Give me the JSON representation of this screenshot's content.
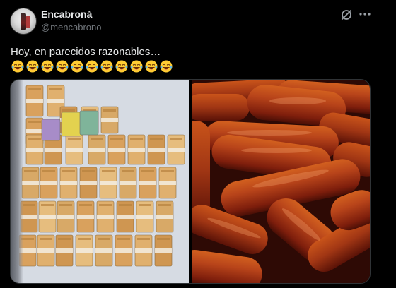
{
  "tweet": {
    "author_name": "Encabroná",
    "author_handle": "@mencabrono",
    "text": "Hoy, en parecidos razonables…",
    "emoji_count": 11,
    "emoji": "laughing-crying-face"
  },
  "icons": {
    "grok": "grok-icon",
    "more": "more-icon"
  },
  "media": {
    "left_image": "euro-banknote-bundles",
    "right_image": "chorizo-sausages"
  },
  "colors": {
    "background": "#000000",
    "text_primary": "#e7e9ea",
    "text_secondary": "#71767b",
    "border": "#2f3336"
  }
}
